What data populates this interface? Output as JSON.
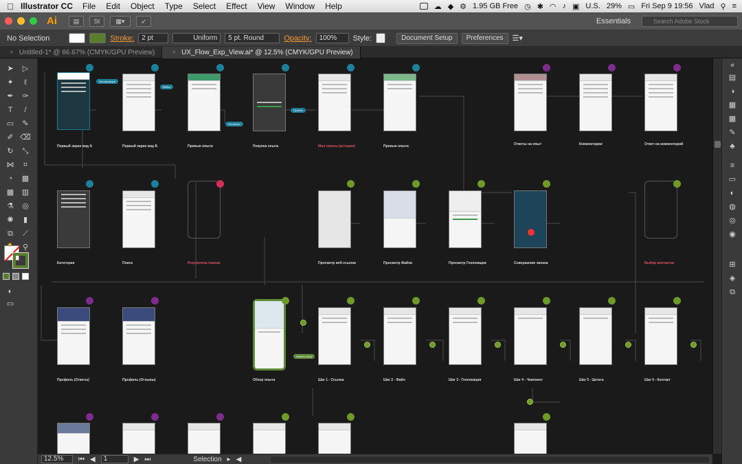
{
  "menubar": {
    "app": "Illustrator CC",
    "items": [
      "File",
      "Edit",
      "Object",
      "Type",
      "Select",
      "Effect",
      "View",
      "Window",
      "Help"
    ],
    "disk": "1.95 GB Free",
    "locale": "U.S.",
    "battery": "29%",
    "clock": "Fri Sep 9  19:56",
    "user": "Vlad"
  },
  "apptop": {
    "logo": "Ai",
    "workspace": "Essentials",
    "search_placeholder": "Search Adobe Stock",
    "st_label": "St"
  },
  "control": {
    "selection": "No Selection",
    "stroke_label": "Stroke:",
    "stroke_value": "2 pt",
    "profile": "Uniform",
    "brush": "5 pt. Round",
    "opacity_label": "Opacity:",
    "opacity_value": "100%",
    "style_label": "Style:",
    "doc_setup": "Document Setup",
    "preferences": "Preferences"
  },
  "tabs": [
    {
      "label": "Untitled-1* @ 66.67% (CMYK/GPU Preview)",
      "active": false
    },
    {
      "label": "UX_Flow_Exp_View.ai* @ 12.5% (CMYK/GPU Preview)",
      "active": true
    }
  ],
  "status": {
    "zoom": "12.5%",
    "page": "1",
    "tool": "Selection"
  },
  "canvas": {
    "captions": [
      {
        "text": "Первый экран вид А",
        "red": false
      },
      {
        "text": "Первый экран вид Б",
        "red": false
      },
      {
        "text": "Превью опыта",
        "red": false
      },
      {
        "text": "Покупка опыта",
        "red": false
      },
      {
        "text": "Мои опыты (история)",
        "red": true
      },
      {
        "text": "Превью опыта",
        "red": false
      },
      {
        "text": "Ответы на опыт",
        "red": false
      },
      {
        "text": "Комментарии",
        "red": false
      },
      {
        "text": "Ответ на комментарий",
        "red": false
      },
      {
        "text": "Категории",
        "red": false
      },
      {
        "text": "Поиск",
        "red": false
      },
      {
        "text": "Результаты поиска",
        "red": true
      },
      {
        "text": "Просмотр веб-ссылки",
        "red": false
      },
      {
        "text": "Просмотр Файла",
        "red": false
      },
      {
        "text": "Просмотр Геолокации",
        "red": false
      },
      {
        "text": "Совершение звонка",
        "red": false
      },
      {
        "text": "Выбор контактов",
        "red": true
      },
      {
        "text": "Профиль (Ответы)",
        "red": false
      },
      {
        "text": "Профиль (Отзывы)",
        "red": false
      },
      {
        "text": "Обзор опыта",
        "red": false
      },
      {
        "text": "Шаг 1 - Ссылка",
        "red": false
      },
      {
        "text": "Шаг 2 - Файл",
        "red": false
      },
      {
        "text": "Шаг 3 - Геолокация",
        "red": false
      },
      {
        "text": "Шаг 4 - Чекпоинт",
        "red": false
      },
      {
        "text": "Шаг 5 - Цитата",
        "red": false
      },
      {
        "text": "Шаг 6 - Контакт",
        "red": false
      }
    ],
    "pills": [
      "Авторизация",
      "Войти",
      "Оплатить",
      "Пройти",
      "Начать опыт"
    ]
  }
}
